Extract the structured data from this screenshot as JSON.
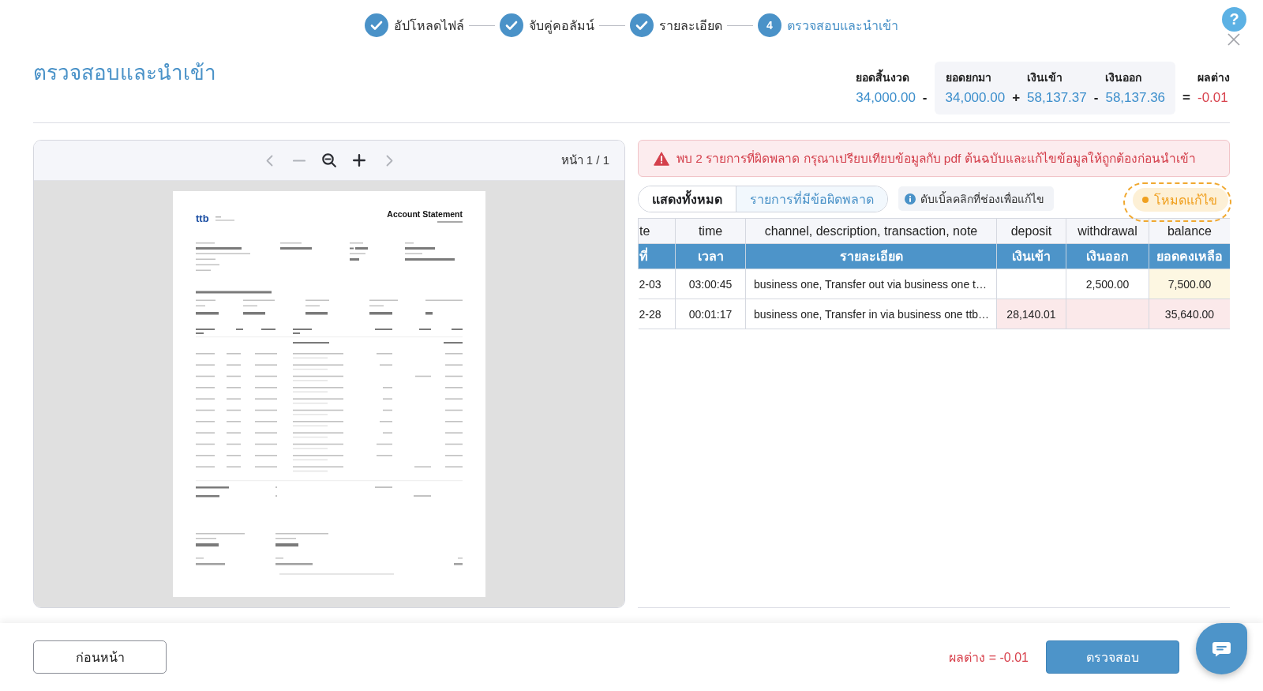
{
  "stepper": {
    "steps": [
      {
        "label": "อัปโหลดไฟล์",
        "completed": true,
        "current": false
      },
      {
        "label": "จับคู่คอลัมน์",
        "completed": true,
        "current": false
      },
      {
        "label": "รายละเอียด",
        "completed": true,
        "current": false
      },
      {
        "label": "ตรวจสอบและนำเข้า",
        "number": "4",
        "completed": false,
        "current": true
      }
    ]
  },
  "help_button": "?",
  "page_title": "ตรวจสอบและนำเข้า",
  "summary": {
    "terms": [
      {
        "kind": "term",
        "label": "ยอดสิ้นงวด",
        "value": "34,000.00"
      },
      {
        "kind": "operator",
        "text": "-"
      },
      {
        "kind": "group",
        "terms": [
          {
            "kind": "term",
            "label": "ยอดยกมา",
            "value": "34,000.00"
          },
          {
            "kind": "operator",
            "text": "+"
          },
          {
            "kind": "term",
            "label": "เงินเข้า",
            "value": "58,137.37"
          },
          {
            "kind": "operator",
            "text": "-"
          },
          {
            "kind": "term",
            "label": "เงินออก",
            "value": "58,137.36"
          }
        ]
      },
      {
        "kind": "operator",
        "text": "="
      },
      {
        "kind": "result",
        "label": "ผลต่าง",
        "value": "-0.01"
      }
    ]
  },
  "preview": {
    "toolbar": [
      {
        "kind": "prev",
        "disabled": true
      },
      {
        "kind": "minus",
        "disabled": true
      },
      {
        "kind": "zoom-out",
        "disabled": false
      },
      {
        "kind": "plus",
        "disabled": false
      },
      {
        "kind": "next",
        "disabled": true
      }
    ],
    "page_indicator": "หน้า 1 / 1",
    "document": {
      "logo": "ttb",
      "title": "Account Statement"
    }
  },
  "alert": {
    "text": "พบ 2 รายการที่ผิดพลาด กรุณาเปรียบเทียบข้อมูลกับ pdf ต้นฉบับและแก้ไขข้อมูลให้ถูกต้องก่อนนำเข้า"
  },
  "filter_tabs": [
    {
      "label": "แสดงทั้งหมด",
      "selected": true
    },
    {
      "label": "รายการที่มีข้อผิดพลาด",
      "selected": false
    }
  ],
  "hint": "ดับเบิ้ลคลิกที่ช่องเพื่อแก้ไข",
  "edit_mode": {
    "label": "โหมดแก้ไข",
    "on": true,
    "highlighted": true
  },
  "table": {
    "columns": [
      {
        "label": "te",
        "label_th": "ที่"
      },
      {
        "label": "time",
        "label_th": "เวลา"
      },
      {
        "label": "channel, description, transaction, note",
        "label_th": "รายละเอียด"
      },
      {
        "label": "deposit",
        "label_th": "เงินเข้า"
      },
      {
        "label": "withdrawal",
        "label_th": "เงินออก"
      },
      {
        "label": "balance",
        "label_th": "ยอดคงเหลือ"
      }
    ],
    "rows": [
      {
        "cells": [
          {
            "text": "2-03",
            "warning": false,
            "error": false
          },
          {
            "text": "03:00:45",
            "warning": false,
            "error": false
          },
          {
            "text": "business one, Transfer out via business one t…",
            "warning": false,
            "error": false
          },
          {
            "warning": false,
            "error": false
          },
          {
            "text": "2,500.00",
            "warning": false,
            "error": false
          },
          {
            "text": "7,500.00",
            "warning": true,
            "error": false
          }
        ]
      },
      {
        "cells": [
          {
            "text": "2-28",
            "warning": false,
            "error": false
          },
          {
            "text": "00:01:17",
            "warning": false,
            "error": false
          },
          {
            "text": "business one, Transfer in via business one ttb…",
            "warning": false,
            "error": false
          },
          {
            "text": "28,140.01",
            "warning": false,
            "error": true
          },
          {
            "warning": false,
            "error": true
          },
          {
            "text": "35,640.00",
            "warning": false,
            "error": true
          }
        ]
      }
    ]
  },
  "footer": {
    "back_button": "ก่อนหน้า",
    "difference": "ผลต่าง = -0.01",
    "submit_button": "ตรวจสอบ"
  }
}
